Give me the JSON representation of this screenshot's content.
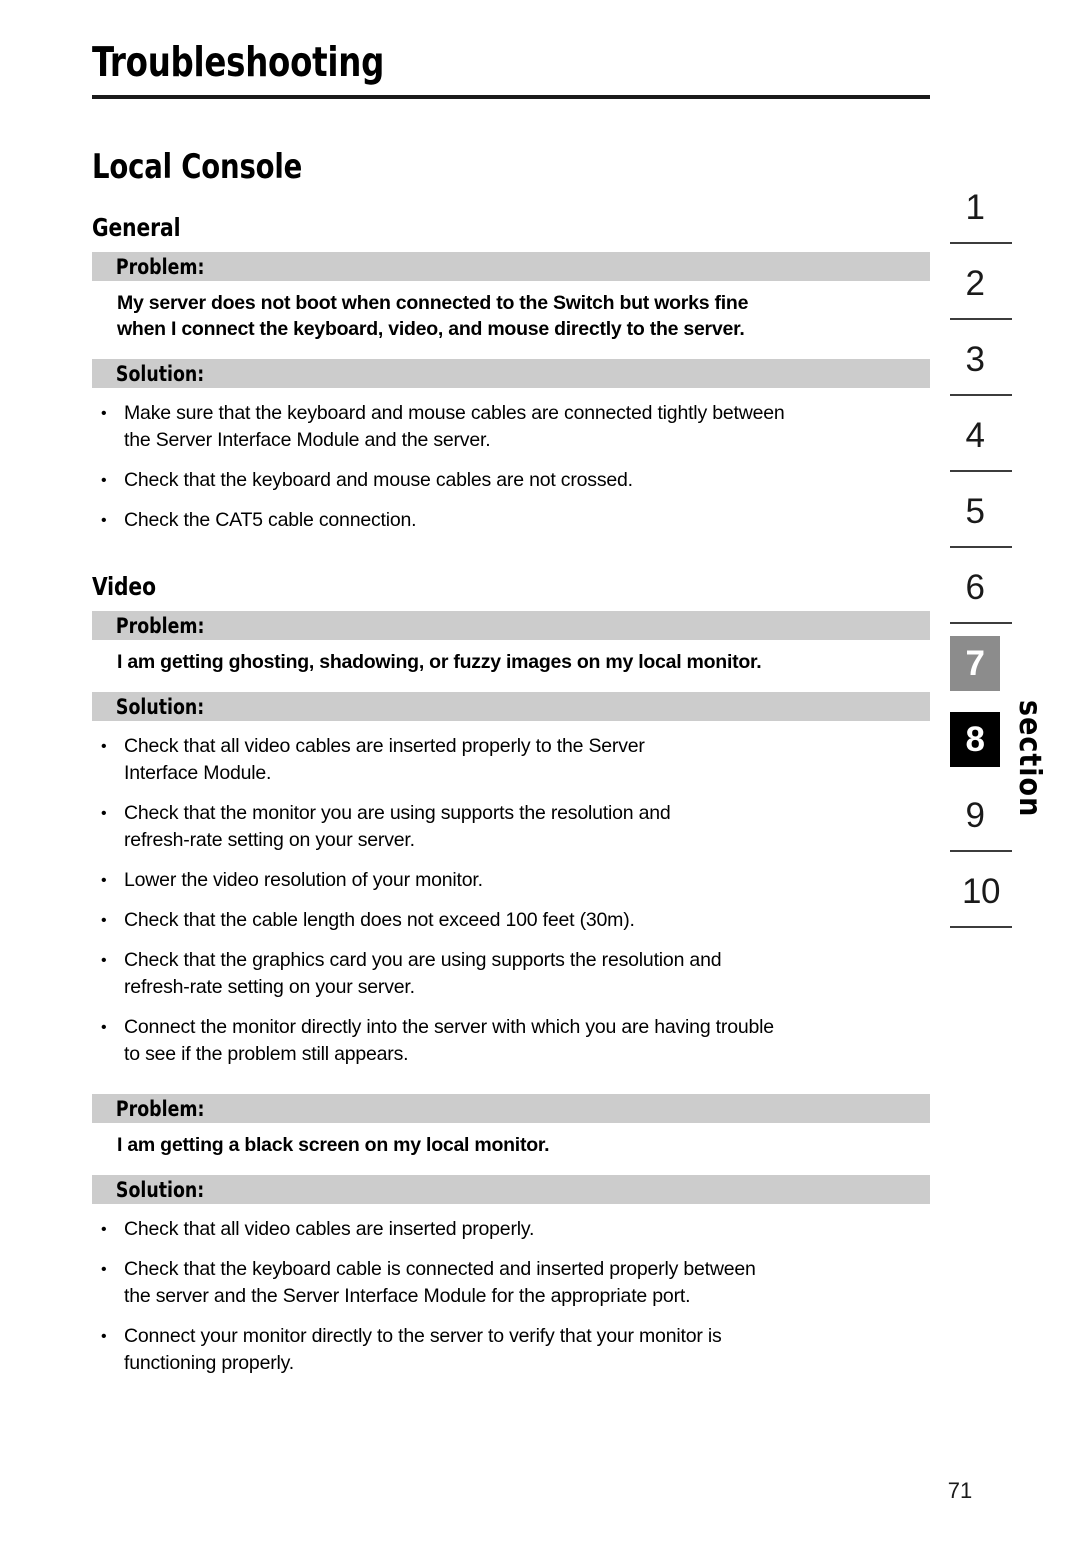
{
  "document": {
    "title": "Troubleshooting",
    "page_number": "71",
    "section_word": "section"
  },
  "chapter": {
    "heading": "Local Console"
  },
  "sections": [
    {
      "heading": "General",
      "blocks": [
        {
          "problem_label": "Problem:",
          "problem_lines": [
            "My server does not boot when connected to the Switch but works fine",
            "when I connect the keyboard, video, and mouse directly to the server."
          ],
          "solution_label": "Solution:",
          "bullets": [
            [
              "Make sure that the keyboard and mouse cables are connected tightly between",
              "the Server Interface Module and the server."
            ],
            [
              "Check that the keyboard and mouse cables are not crossed."
            ],
            [
              "Check the CAT5 cable connection."
            ]
          ]
        }
      ]
    },
    {
      "heading": "Video",
      "blocks": [
        {
          "problem_label": "Problem:",
          "problem_lines": [
            "I am getting ghosting, shadowing, or fuzzy images on my local monitor."
          ],
          "solution_label": "Solution:",
          "bullets": [
            [
              "Check that all video cables are inserted properly to the Server",
              "Interface Module."
            ],
            [
              "Check that the monitor you are using supports the resolution and",
              "refresh-rate setting on your server."
            ],
            [
              "Lower the video resolution of your monitor."
            ],
            [
              "Check that the cable length does not exceed 100 feet (30m)."
            ],
            [
              "Check that the graphics card you are using supports the resolution and",
              "refresh-rate setting on your server."
            ],
            [
              "Connect the monitor directly into the server with which you are having trouble",
              "to see if the problem still appears."
            ]
          ]
        },
        {
          "problem_label": "Problem:",
          "problem_lines": [
            "I am getting a black screen on my local monitor."
          ],
          "solution_label": "Solution:",
          "bullets": [
            [
              "Check that all video cables are inserted properly."
            ],
            [
              "Check that the keyboard cable is connected and inserted properly between",
              "the server and the Server Interface Module for the appropriate port."
            ],
            [
              "Connect your monitor directly to the server to verify that your monitor is",
              "functioning properly."
            ]
          ]
        }
      ]
    }
  ],
  "section_index": {
    "items": [
      {
        "number": "1",
        "state": "plain"
      },
      {
        "number": "2",
        "state": "plain"
      },
      {
        "number": "3",
        "state": "plain"
      },
      {
        "number": "4",
        "state": "plain"
      },
      {
        "number": "5",
        "state": "plain"
      },
      {
        "number": "6",
        "state": "plain"
      },
      {
        "number": "7",
        "state": "gray"
      },
      {
        "number": "8",
        "state": "black"
      },
      {
        "number": "9",
        "state": "plain"
      },
      {
        "number": "10",
        "state": "plain"
      }
    ]
  },
  "colors": {
    "bar_gray": "#cccccc",
    "tab_gray": "#8c8c8c",
    "tab_active": "#000000",
    "rule": "#1a1a1a"
  }
}
